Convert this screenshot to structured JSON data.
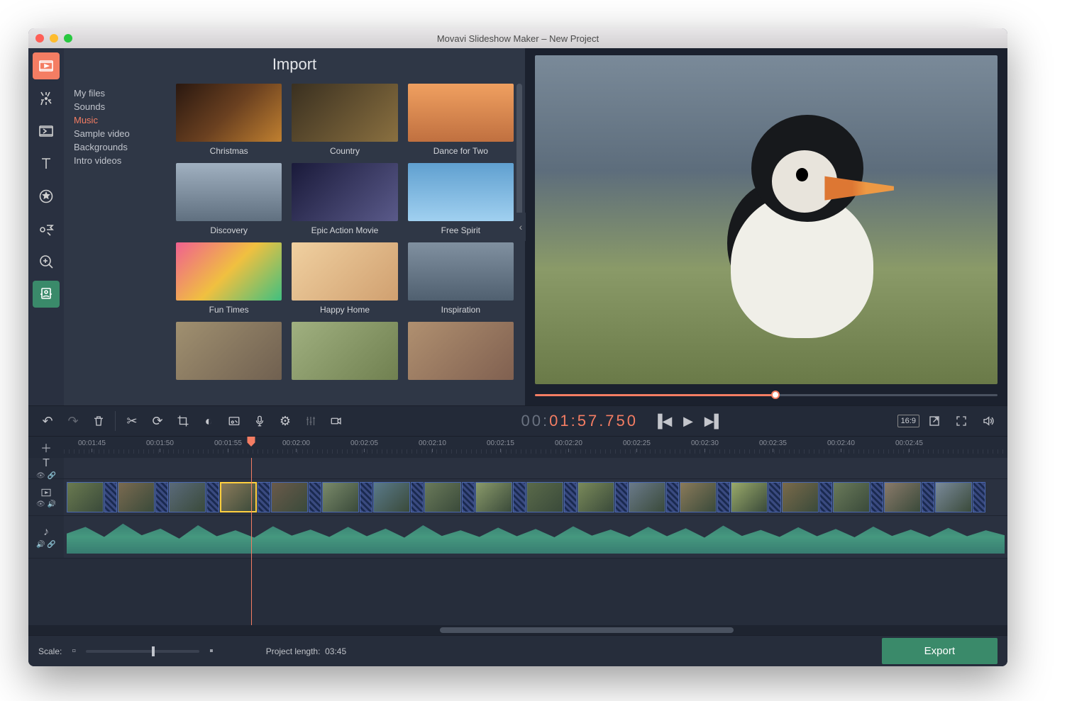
{
  "titlebar": {
    "title": "Movavi Slideshow Maker – New Project"
  },
  "import": {
    "title": "Import",
    "categories": [
      {
        "label": "My files",
        "sel": false
      },
      {
        "label": "Sounds",
        "sel": false
      },
      {
        "label": "Music",
        "sel": true
      },
      {
        "label": "Sample video",
        "sel": false
      },
      {
        "label": "Backgrounds",
        "sel": false
      },
      {
        "label": "Intro videos",
        "sel": false
      }
    ],
    "items": [
      {
        "label": "Christmas"
      },
      {
        "label": "Country"
      },
      {
        "label": "Dance for Two"
      },
      {
        "label": "Discovery"
      },
      {
        "label": "Epic Action Movie"
      },
      {
        "label": "Free Spirit"
      },
      {
        "label": "Fun Times"
      },
      {
        "label": "Happy Home"
      },
      {
        "label": "Inspiration"
      }
    ]
  },
  "playback": {
    "timecode_pre": "00:",
    "timecode_hl": "01:57.750",
    "ratio": "16:9"
  },
  "ruler": [
    "00:01:45",
    "00:01:50",
    "00:01:55",
    "00:02:00",
    "00:02:05",
    "00:02:10",
    "00:02:15",
    "00:02:20",
    "00:02:25",
    "00:02:30",
    "00:02:35",
    "00:02:40",
    "00:02:45"
  ],
  "footer": {
    "scale_label": "Scale:",
    "proj_label": "Project length:",
    "proj_value": "03:45",
    "export": "Export"
  }
}
